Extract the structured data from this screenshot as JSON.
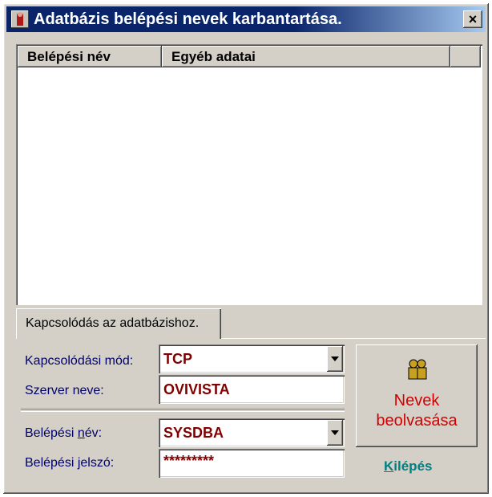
{
  "window": {
    "title": "Adatbázis belépési nevek karbantartása.",
    "close_label": "×"
  },
  "list": {
    "columns": [
      "Belépési név",
      "Egyéb adatai",
      ""
    ],
    "rows": []
  },
  "tabs": [
    {
      "label": "Kapcsolódás az adatbázishoz."
    }
  ],
  "form": {
    "mode_label": "Kapcsolódási mód:",
    "mode_value": "TCP",
    "server_label": "Szerver neve:",
    "server_value": "OVIVISTA",
    "user_label_pre": "Belépési ",
    "user_label_access": "n",
    "user_label_post": "év:",
    "user_value": "SYSDBA",
    "password_label": "Belépési jelszó:",
    "password_value": "*********"
  },
  "actions": {
    "read_names_line1": "Nevek",
    "read_names_line2": "beolvasása",
    "exit_access": "K",
    "exit_rest": "ilépés"
  },
  "icons": {
    "app": "user-icon",
    "read_names": "people-icon",
    "dropdown": "chevron-down-icon"
  },
  "colors": {
    "title_bar": "#0a246a",
    "field_text": "#800000",
    "label_text": "#00006a",
    "read_names_text": "#d40000",
    "exit_text": "#008080"
  }
}
